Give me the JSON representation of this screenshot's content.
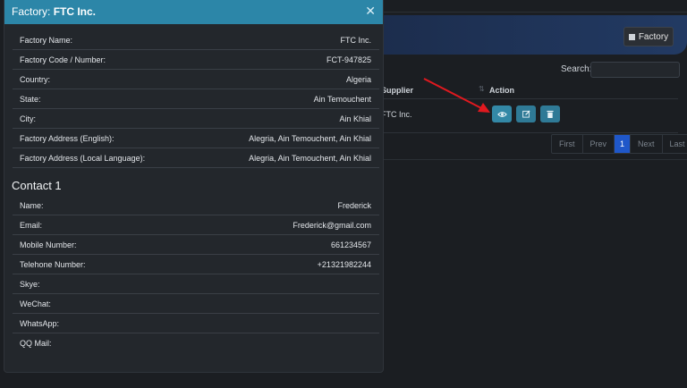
{
  "modal": {
    "title_prefix": "Factory:",
    "title_name": "FTC Inc.",
    "factory_rows": [
      {
        "label": "Factory Name:",
        "value": "FTC Inc."
      },
      {
        "label": "Factory Code / Number:",
        "value": "FCT-947825"
      },
      {
        "label": "Country:",
        "value": "Algeria"
      },
      {
        "label": "State:",
        "value": "Ain Temouchent"
      },
      {
        "label": "City:",
        "value": "Ain Khial"
      },
      {
        "label": "Factory Address (English):",
        "value": "Alegria, Ain Temouchent, Ain Khial"
      },
      {
        "label": "Factory Address (Local Language):",
        "value": "Alegria, Ain Temouchent, Ain Khial"
      }
    ],
    "contact_title": "Contact 1",
    "contact_rows": [
      {
        "label": "Name:",
        "value": "Frederick"
      },
      {
        "label": "Email:",
        "value": "Frederick@gmail.com"
      },
      {
        "label": "Mobile Number:",
        "value": "661234567"
      },
      {
        "label": "Telehone Number:",
        "value": "+21321982244"
      },
      {
        "label": "Skye:",
        "value": ""
      },
      {
        "label": "WeChat:",
        "value": ""
      },
      {
        "label": "WhatsApp:",
        "value": ""
      },
      {
        "label": "QQ Mail:",
        "value": ""
      }
    ]
  },
  "background": {
    "factory_button": "Factory",
    "search_label": "Search:",
    "columns": {
      "supplier": "Supplier",
      "action": "Action"
    },
    "row_supplier": "FTC Inc.",
    "pagination": {
      "first": "First",
      "prev": "Prev",
      "current": "1",
      "next": "Next",
      "last": "Last"
    }
  },
  "colors": {
    "modal_header": "#2c86a8",
    "action_button": "#2f7a96",
    "page_active": "#1f57c9",
    "arrow": "#e0191f"
  },
  "icons": {
    "view": "eye-icon",
    "edit": "edit-icon",
    "delete": "trash-icon",
    "close": "close-icon",
    "factory_button": "plus-square-icon"
  }
}
